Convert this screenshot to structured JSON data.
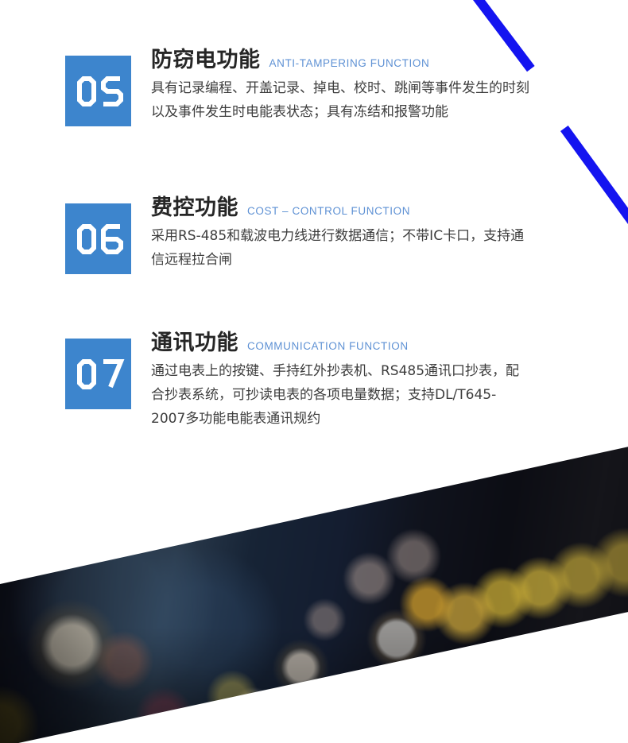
{
  "page": {
    "background_color": "#ffffff",
    "accent_blue": "#3d85cd",
    "stripe_blue": "#1414f0",
    "en_subtitle_color": "#5e91d4",
    "title_color": "#262626",
    "body_color": "#3d3d3d"
  },
  "decor": {
    "stripe_1_name": "blue-diagonal-stripe-upper",
    "stripe_2_name": "blue-diagonal-stripe-lower",
    "photo_band_name": "city-bokeh-photo-band"
  },
  "features": [
    {
      "number": "05",
      "cn_title": "防窃电功能",
      "en_title": "ANTI-TAMPERING FUNCTION",
      "description": "具有记录编程、开盖记录、掉电、校时、跳闸等事件发生的时刻以及事件发生时电能表状态；具有冻结和报警功能"
    },
    {
      "number": "06",
      "cn_title": "费控功能",
      "en_title": "COST – CONTROL FUNCTION",
      "description": "采用RS-485和载波电力线进行数据通信；不带IC卡口，支持通信远程拉合闸"
    },
    {
      "number": "07",
      "cn_title": "通讯功能",
      "en_title": "COMMUNICATION FUNCTION",
      "description": "通过电表上的按键、手持红外抄表机、RS485通讯口抄表，配合抄表系统，可抄读电表的各项电量数据；支持DL/T645-2007多功能电能表通讯规约"
    }
  ]
}
